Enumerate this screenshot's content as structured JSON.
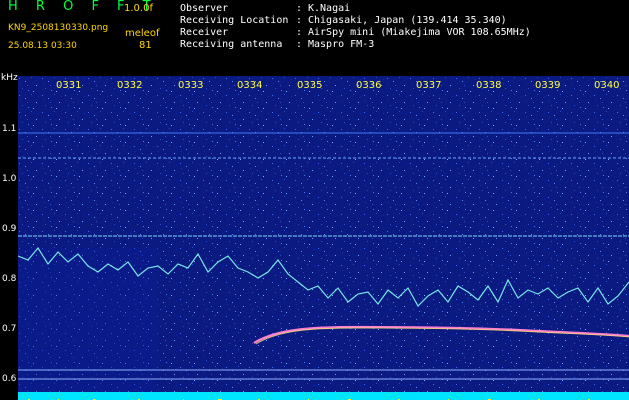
{
  "header": {
    "app_title": "H R O F F T",
    "app_version": "1.0.0f",
    "file_name": "KN9_2508130330.png",
    "meleo_label": "meleof",
    "datetime": "25.08.13 03:30",
    "meleo_count": "81"
  },
  "info": [
    {
      "label": "Observer",
      "value": "K.Nagai"
    },
    {
      "label": "Receiving Location",
      "value": "Chigasaki, Japan (139.414 35.340)"
    },
    {
      "label": "Receiver",
      "value": "AirSpy mini (Miakejima VOR 108.65MHz)"
    },
    {
      "label": "Receiving antenna",
      "value": "Maspro FM-3"
    }
  ],
  "axis": {
    "y_unit": "kHz",
    "y_ticks": [
      "1.1",
      "1.0",
      "0.9",
      "0.8",
      "0.7",
      "0.6"
    ],
    "x_ticks": [
      "0331",
      "0332",
      "0333",
      "0334",
      "0335",
      "0336",
      "0337",
      "0338",
      "0339",
      "0340"
    ]
  },
  "colors": {
    "background": "#000000",
    "spectrogram": "#0a1a80",
    "title": "#00ff40",
    "meta": "#ffd700",
    "tick_label": "#ffff40",
    "footer": "#00e5ff"
  }
}
